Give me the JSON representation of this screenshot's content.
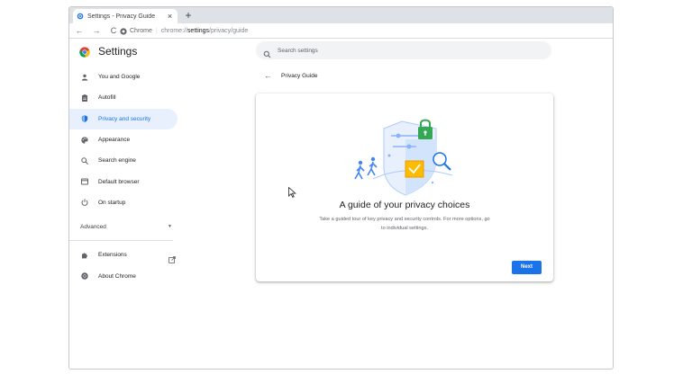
{
  "tab": {
    "title": "Settings - Privacy Guide",
    "close": "×",
    "new_tab": "+"
  },
  "toolbar": {
    "back": "←",
    "forward": "→",
    "reload": "C"
  },
  "omnibox": {
    "chrome_label": "Chrome",
    "separator": "|",
    "scheme": "chrome://",
    "host": "settings",
    "path": "/privacy/guide"
  },
  "settings": {
    "title": "Settings"
  },
  "search": {
    "placeholder": "Search settings"
  },
  "sidebar": {
    "items": [
      {
        "label": "You and Google",
        "icon": "person-icon"
      },
      {
        "label": "Autofill",
        "icon": "clipboard-icon"
      },
      {
        "label": "Privacy and security",
        "icon": "shield-icon",
        "active": true
      },
      {
        "label": "Appearance",
        "icon": "palette-icon"
      },
      {
        "label": "Search engine",
        "icon": "search-icon"
      },
      {
        "label": "Default browser",
        "icon": "browser-icon"
      },
      {
        "label": "On startup",
        "icon": "power-icon"
      }
    ],
    "advanced": {
      "label": "Advanced",
      "caret": "▼"
    },
    "bottom_items": [
      {
        "label": "Extensions",
        "icon": "puzzle-icon"
      },
      {
        "label": "About Chrome",
        "icon": "chrome-icon"
      }
    ]
  },
  "main": {
    "back_title": "Privacy Guide",
    "card": {
      "heading": "A guide of your privacy choices",
      "description": "Take a guided tour of key privacy and security controls. For more options, go to individual settings.",
      "next": "Next"
    }
  },
  "colors": {
    "accent": "#1a73e8",
    "active_bg": "#e8f0fe",
    "tabstrip": "#dee1e6"
  }
}
